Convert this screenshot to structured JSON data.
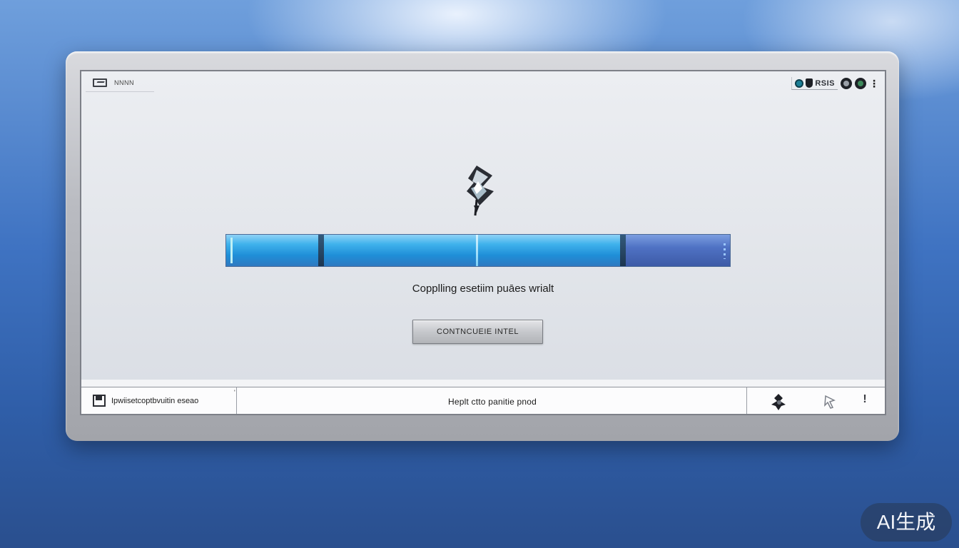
{
  "window": {
    "title": "NNNN",
    "tray_text": "RSIS"
  },
  "main": {
    "status_text": "Copplling esetiim puāes wrialt",
    "continue_button_label": "CONTNCUEIE INTEL",
    "progress_fraction": 0.79
  },
  "footer": {
    "left_text": "Ipwiisetcoptbvuitin eseao",
    "center_text": "Heplt ctto panitie pnod",
    "alert_glyph": "!"
  },
  "watermark": {
    "text": "AI生成"
  },
  "colors": {
    "progress_fill": "#1f8fd8",
    "progress_rest": "#4f72c4",
    "background": "#3f73c2"
  },
  "icons": [
    "app-logo-icon",
    "teal-dot-icon",
    "shield-icon",
    "round-button-icon",
    "kebab-menu-icon",
    "pen-nib-icon",
    "save-icon",
    "bug-icon",
    "cursor-icon",
    "alert-icon"
  ]
}
